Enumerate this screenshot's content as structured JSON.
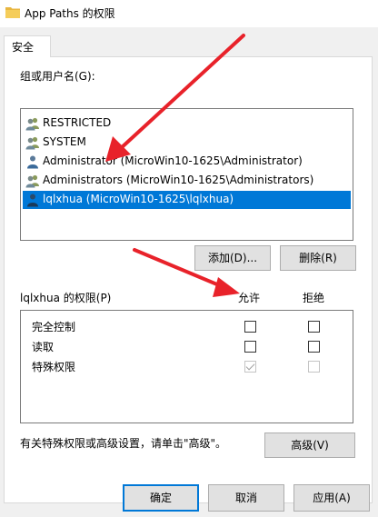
{
  "window": {
    "title": "App Paths 的权限"
  },
  "tabs": [
    {
      "label": "安全",
      "active": true
    }
  ],
  "users_section": {
    "label": "组或用户名(G):",
    "users": [
      {
        "name": "RESTRICTED",
        "icon": "user-group-icon",
        "selected": false
      },
      {
        "name": "SYSTEM",
        "icon": "user-group-icon",
        "selected": false
      },
      {
        "name": "Administrator (MicroWin10-1625\\Administrator)",
        "icon": "user-icon",
        "selected": false
      },
      {
        "name": "Administrators (MicroWin10-1625\\Administrators)",
        "icon": "user-group-icon",
        "selected": false
      },
      {
        "name": "lqlxhua (MicroWin10-1625\\lqlxhua)",
        "icon": "user-icon",
        "selected": true
      }
    ],
    "add_label": "添加(D)...",
    "remove_label": "删除(R)"
  },
  "permissions_section": {
    "label": "lqlxhua 的权限(P)",
    "allow_header": "允许",
    "deny_header": "拒绝",
    "permissions": [
      {
        "name": "完全控制",
        "allow": false,
        "deny": false,
        "disabled": false
      },
      {
        "name": "读取",
        "allow": false,
        "deny": false,
        "disabled": false
      },
      {
        "name": "特殊权限",
        "allow": true,
        "deny": false,
        "disabled": true
      }
    ]
  },
  "advanced": {
    "note": "有关特殊权限或高级设置，请单击\"高级\"。",
    "button_label": "高级(V)"
  },
  "footer": {
    "ok_label": "确定",
    "cancel_label": "取消",
    "apply_label": "应用(A)"
  },
  "colors": {
    "selection": "#0078d7",
    "annotation_arrow": "#e8222a"
  }
}
